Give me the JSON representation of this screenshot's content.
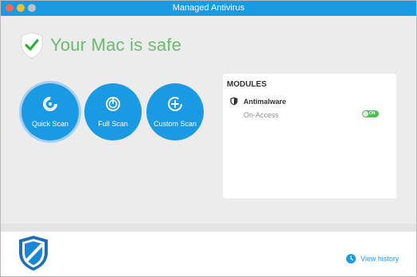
{
  "window": {
    "title": "Managed Antivirus"
  },
  "status": {
    "message": "Your Mac is safe",
    "color": "#6cbb6f"
  },
  "scans": [
    {
      "label": "Quick Scan",
      "icon": "quick-scan-icon",
      "selected": true
    },
    {
      "label": "Full Scan",
      "icon": "full-scan-icon",
      "selected": false
    },
    {
      "label": "Custom Scan",
      "icon": "custom-scan-icon",
      "selected": false
    }
  ],
  "modules": {
    "title": "MODULES",
    "items": [
      {
        "name": "Antimalware",
        "setting": "On-Access",
        "toggle_text": "ON",
        "enabled": true
      }
    ]
  },
  "footer": {
    "history_label": "View history"
  },
  "colors": {
    "accent": "#1a9ae3",
    "toggle_on": "#4cbf52",
    "background": "#ececec"
  }
}
